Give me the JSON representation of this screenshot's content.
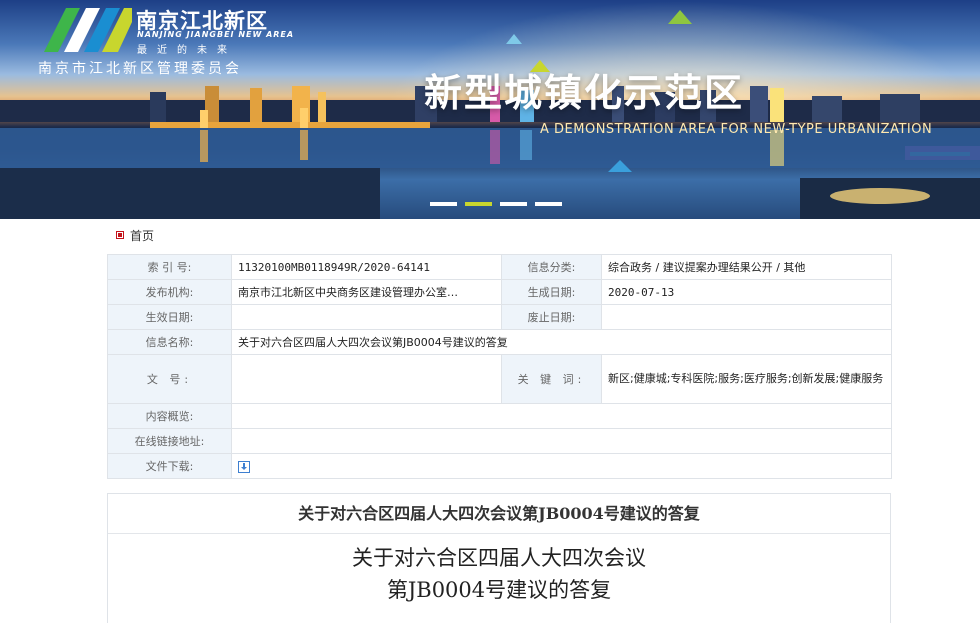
{
  "banner": {
    "logo_cn": "南京江北新区",
    "logo_en": "NANJING JIANGBEI NEW AREA",
    "logo_slogan": "最近的未来",
    "org_name": "南京市江北新区管理委员会",
    "title": "新型城镇化示范区",
    "subtitle": "A DEMONSTRATION AREA FOR NEW-TYPE URBANIZATION",
    "carousel_count": 4,
    "carousel_active_index": 1,
    "accent_color": "#c8d62e"
  },
  "breadcrumb": {
    "icon": "home-square-icon",
    "home_label": "首页"
  },
  "info": {
    "index_label": "索 引 号:",
    "index_value": "11320100MB0118949R/2020-64141",
    "category_label": "信息分类:",
    "category_value": "综合政务 / 建议提案办理结果公开 / 其他",
    "publisher_label": "发布机构:",
    "publisher_value": "南京市江北新区中央商务区建设管理办公室…",
    "created_label": "生成日期:",
    "created_value": "2020-07-13",
    "effective_label": "生效日期:",
    "effective_value": "",
    "expired_label": "废止日期:",
    "expired_value": "",
    "name_label": "信息名称:",
    "name_value": "关于对六合区四届人大四次会议第JB0004号建议的答复",
    "doc_no_label": "文 号:",
    "doc_no_value": "",
    "keywords_label": "关 键 词:",
    "keywords_value": "新区;健康城;专科医院;服务;医疗服务;创新发展;健康服务",
    "summary_label": "内容概览:",
    "summary_value": "",
    "link_label": "在线链接地址:",
    "link_value": "",
    "download_label": "文件下载:",
    "download_icon": "download-icon"
  },
  "article": {
    "header_title": "关于对六合区四届人大四次会议第JB0004号建议的答复",
    "body_title_line1": "关于对六合区四届人大四次会议",
    "body_title_line2": "第JB0004号建议的答复"
  }
}
